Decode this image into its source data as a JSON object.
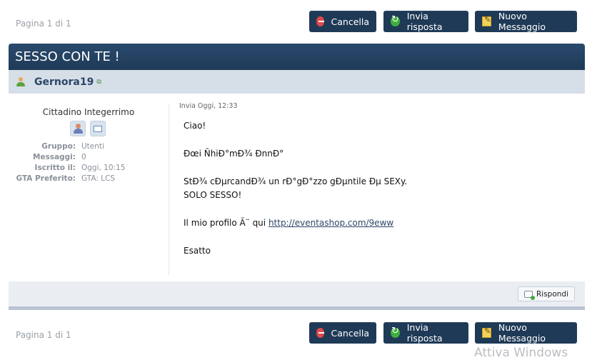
{
  "pagination": {
    "top": "Pagina 1 di 1",
    "bottom": "Pagina 1 di 1"
  },
  "actions": {
    "cancel": {
      "label": "Cancella",
      "icon": "cancel-icon"
    },
    "reply": {
      "label": "Invia risposta",
      "icon": "reply-icon"
    },
    "new_message": {
      "label": "Nuovo Messaggio",
      "icon": "new-message-icon"
    }
  },
  "post": {
    "title": "SESSO CON TE !",
    "author": {
      "name": "Gernora19",
      "rank": "Cittadino Integerrimo"
    },
    "stats": [
      {
        "key": "Gruppo:",
        "value": "Utenti"
      },
      {
        "key": "Messaggi:",
        "value": "0"
      },
      {
        "key": "Iscritto il:",
        "value": "Oggi, 10:15"
      },
      {
        "key": "GTA Preferito:",
        "value": "GTA: LCS"
      }
    ],
    "date": "Invia Oggi, 12:33",
    "body": {
      "line1": "Ciao!",
      "line2": "Ðœi ÑhiÐ°mÐ¾ ÐnnÐ°",
      "line3": "StÐ¾ cÐµrcandÐ¾ un rÐ°gÐ°zzo gÐµntile Ðµ SEXy.",
      "line4": "SOLO SESSO!",
      "line5_prefix": "Il mio profilo Ã¨ qui ",
      "line5_link": "http://eventashop.com/9eww",
      "line6": "Esatto"
    },
    "reply_button": "Rispondi"
  },
  "colors": {
    "header": "#1f3a57",
    "author_bar": "#d6dee8",
    "button": "#1f3a57"
  },
  "watermark": "Attiva Windows"
}
